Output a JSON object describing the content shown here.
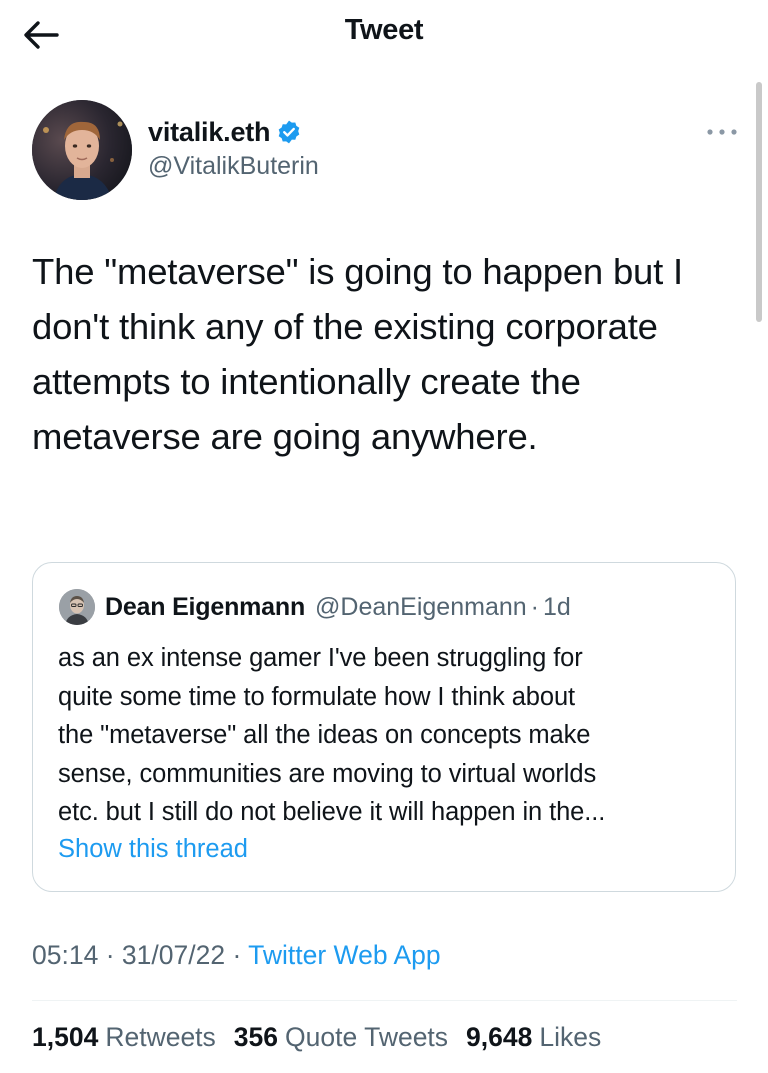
{
  "header": {
    "title": "Tweet",
    "back_icon": "arrow-left-icon"
  },
  "author": {
    "display_name": "vitalik.eth",
    "handle": "@VitalikButerin",
    "verified": true,
    "verified_color": "#1d9bf0"
  },
  "tweet": {
    "text": "The \"metaverse\" is going to happen but I don't think any of the existing corporate attempts to intentionally create the metaverse are going anywhere."
  },
  "quoted_tweet": {
    "display_name": "Dean Eigenmann",
    "handle": "@DeanEigenmann",
    "separator": "·",
    "time": "1d",
    "text_lines": [
      "as an ex intense gamer I've been struggling for",
      "quite some time to formulate how I think about",
      "the \"metaverse\" all the ideas on concepts make",
      "sense, communities are moving to virtual worlds",
      "etc. but I still do not believe it will happen in the..."
    ],
    "show_thread": "Show this thread"
  },
  "meta": {
    "time": "05:14",
    "separator": "·",
    "date": "31/07/22",
    "source": "Twitter Web App"
  },
  "stats": {
    "retweets_count": "1,504",
    "retweets_label": "Retweets",
    "quotes_count": "356",
    "quotes_label": "Quote Tweets",
    "likes_count": "9,648",
    "likes_label": "Likes"
  },
  "colors": {
    "accent": "#1d9bf0",
    "secondary_text": "#536471",
    "primary_text": "#0f1419",
    "border": "#cfd9de"
  }
}
